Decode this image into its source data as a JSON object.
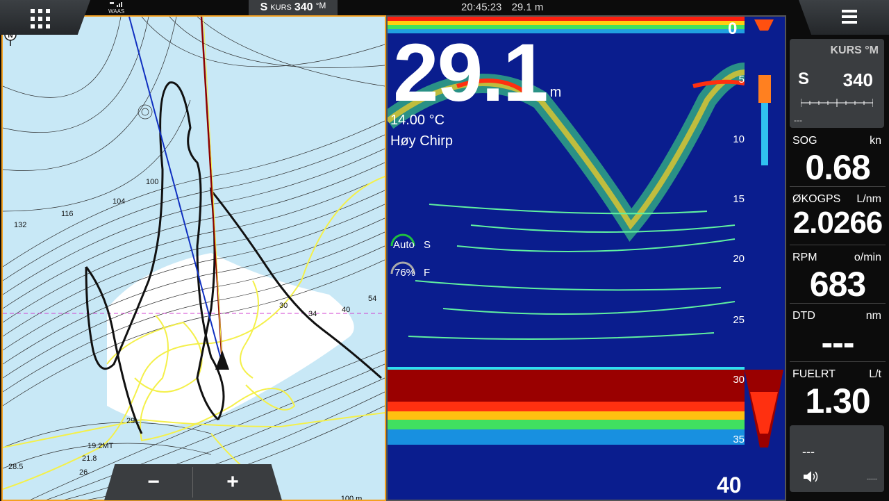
{
  "topbar": {
    "gps_label": "WAAS",
    "heading": {
      "prefix": "S",
      "kurs": "KURS",
      "value": "340",
      "unit": "°M"
    },
    "time": "20:45:23",
    "depth": "29.1 m"
  },
  "chart": {
    "depth_labels": [
      "100",
      "104",
      "116",
      "132",
      "30",
      "34",
      "40",
      "54",
      "29",
      "19.2MT",
      "21.8",
      "26",
      "28.5"
    ],
    "scale_label": "100 m",
    "north_label": "N",
    "zoom_out": "−",
    "zoom_in": "+",
    "colors": {
      "land": "#ffffff",
      "water": "#c8e8f6",
      "track": "#111111",
      "trail": "#f4f04a",
      "heading": "#1030c0",
      "cog": "#8b0000"
    }
  },
  "sonar": {
    "depth_value": "29.1",
    "depth_unit": "m",
    "temperature": "14.00 °C",
    "frequency": "Høy Chirp",
    "gain_auto": "Auto",
    "gain_letter": "S",
    "color_pct": "76%",
    "color_letter": "F",
    "scale": [
      "0",
      "5",
      "10",
      "15",
      "20",
      "25",
      "30",
      "35",
      "40"
    ],
    "bottom_depth_m": 29.1,
    "range_m": 40
  },
  "sidebar": {
    "kurs": {
      "title": "KURS  °M",
      "letter": "S",
      "value": "340",
      "dashes": "---"
    },
    "fields": [
      {
        "label": "SOG",
        "unit": "kn",
        "value": "0.68"
      },
      {
        "label": "ØKOGPS",
        "unit": "L/nm",
        "value": "2.0266"
      },
      {
        "label": "RPM",
        "unit": "o/min",
        "value": "683"
      },
      {
        "label": "DTD",
        "unit": "nm",
        "value": "---"
      },
      {
        "label": "FUELRT",
        "unit": "L/t",
        "value": "1.30"
      }
    ],
    "volume": {
      "dashes": "---",
      "small": "-----"
    }
  }
}
